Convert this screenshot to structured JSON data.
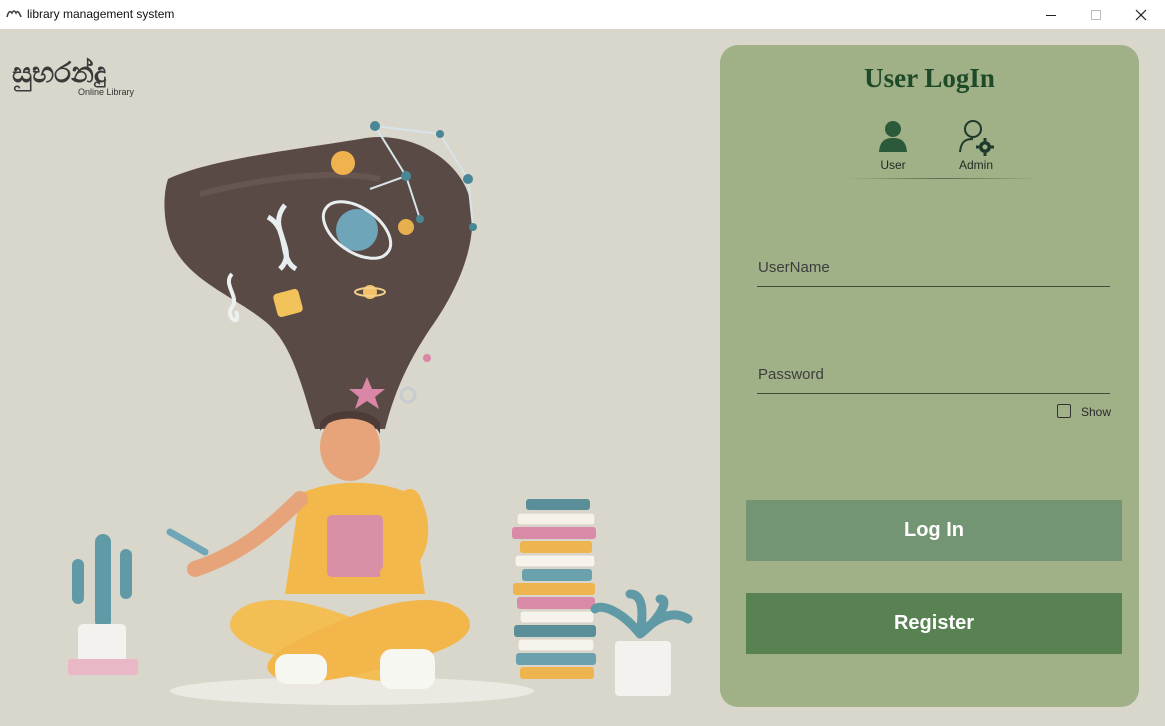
{
  "window": {
    "title": "library management system",
    "icon": "app-logo-icon",
    "controls": [
      "minimize-icon",
      "maximize-icon",
      "close-icon"
    ]
  },
  "logo": {
    "main_text": "සුභරන්දු",
    "sub_text": "Online Library"
  },
  "login": {
    "title": "User LogIn",
    "roles": [
      {
        "label": "User",
        "icon": "user-icon"
      },
      {
        "label": "Admin",
        "icon": "admin-gear-icon"
      }
    ],
    "username_placeholder": "UserName",
    "username_value": "",
    "password_placeholder": "Password",
    "password_value": "",
    "show_label": "Show",
    "show_checked": false,
    "login_label": "Log In",
    "register_label": "Register"
  },
  "colors": {
    "background": "#d9d6cb",
    "panel": "#a0b087",
    "title_text": "#1f4a28",
    "login_button": "#749574",
    "register_button": "#588252"
  }
}
